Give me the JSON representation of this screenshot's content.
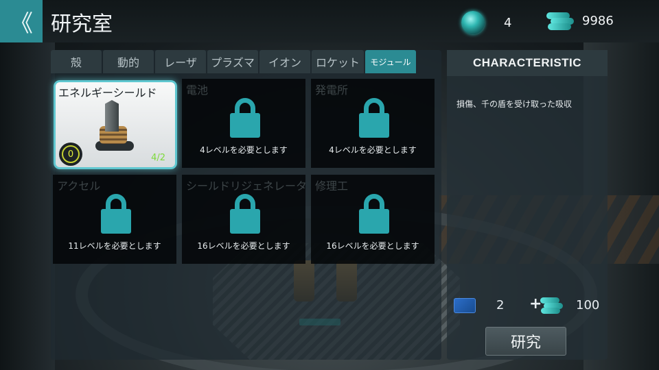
{
  "header": {
    "back_glyph": "《",
    "title": "研究室",
    "gems": "4",
    "crystals": "9986",
    "gem_icon": "green-orb-icon",
    "crystal_icon": "crystal-bars-icon"
  },
  "tabs": [
    {
      "label": "殻",
      "active": false
    },
    {
      "label": "動的",
      "active": false
    },
    {
      "label": "レーザ",
      "active": false
    },
    {
      "label": "プラズマ",
      "active": false
    },
    {
      "label": "イオン",
      "active": false
    },
    {
      "label": "ロケット",
      "active": false
    },
    {
      "label": "モジュール",
      "active": true
    }
  ],
  "modules": [
    {
      "title": "エネルギーシールド",
      "selected": true,
      "level_badge": "0",
      "ratio": "4/2",
      "icon": "energy-shield-icon"
    },
    {
      "title": "電池",
      "requirement": "4レベルを必要とします",
      "locked": true
    },
    {
      "title": "発電所",
      "requirement": "4レベルを必要とします",
      "locked": true
    },
    {
      "title": "アクセル",
      "requirement": "11レベルを必要とします",
      "locked": true
    },
    {
      "title": "シールドリジェネレータ",
      "requirement": "16レベルを必要とします",
      "locked": true
    },
    {
      "title": "修理工",
      "requirement": "16レベルを必要とします",
      "locked": true
    }
  ],
  "characteristic": {
    "header": "CHARACTERISTIC",
    "description": "損傷、千の盾を受け取った吸収"
  },
  "cost": {
    "blueprints": "2",
    "plus": "+",
    "crystals": "100"
  },
  "research_button": "研究",
  "colors": {
    "accent": "#2b8b93",
    "lock": "#2aa6ad",
    "selected_border": "#5fc7d0",
    "ratio_green": "#7dd93a",
    "badge_yellow": "#e4f13a"
  }
}
